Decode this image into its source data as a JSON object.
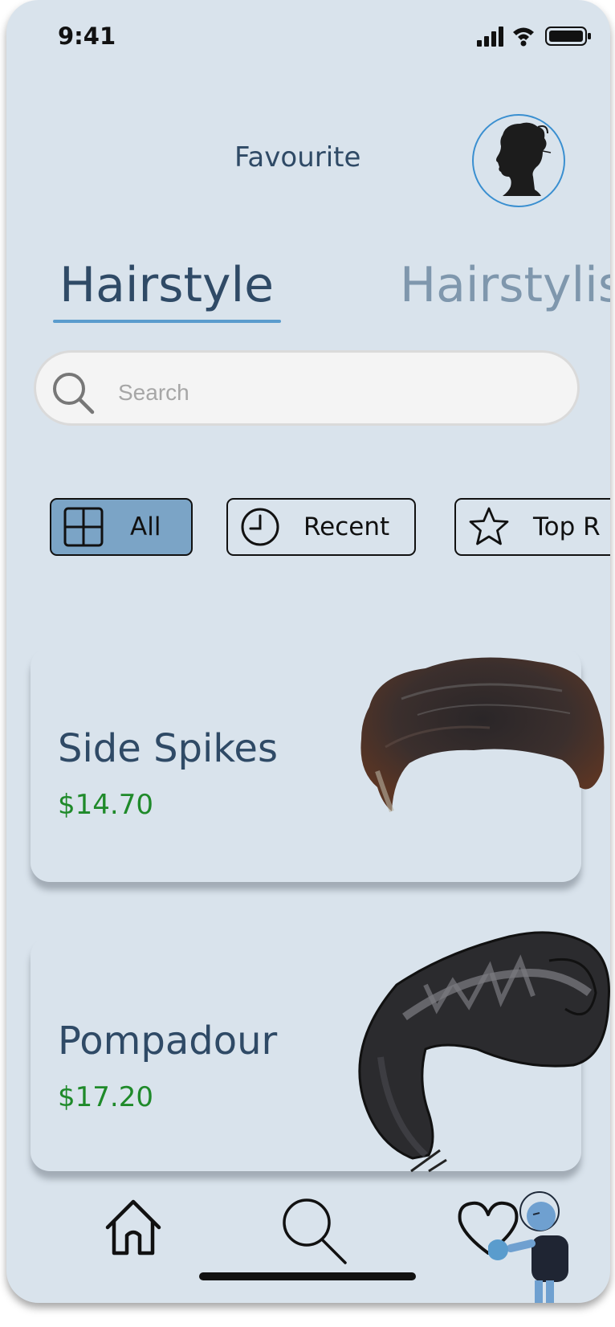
{
  "status": {
    "time": "9:41"
  },
  "header": {
    "title": "Favourite"
  },
  "tabs": [
    {
      "label": "Hairstyle",
      "active": true
    },
    {
      "label": "Hairstylis",
      "active": false
    }
  ],
  "search": {
    "placeholder": "Search",
    "value": ""
  },
  "filters": [
    {
      "label": "All",
      "icon": "grid-icon",
      "selected": true
    },
    {
      "label": "Recent",
      "icon": "clock-icon",
      "selected": false
    },
    {
      "label": "Top R",
      "icon": "star-icon",
      "selected": false
    }
  ],
  "items": [
    {
      "name": "Side Spikes",
      "price": "$14.70",
      "image": "side-spikes-hair"
    },
    {
      "name": "Pompadour",
      "price": "$17.20",
      "image": "pompadour-hair"
    }
  ],
  "bottom_nav": [
    {
      "icon": "home-icon"
    },
    {
      "icon": "search-icon"
    },
    {
      "icon": "heart-icon"
    }
  ],
  "colors": {
    "background": "#d9e3ec",
    "accent": "#5a9ccd",
    "title": "#2f4a66",
    "price": "#1f8a2a",
    "chip_selected": "#7ba4c6"
  }
}
